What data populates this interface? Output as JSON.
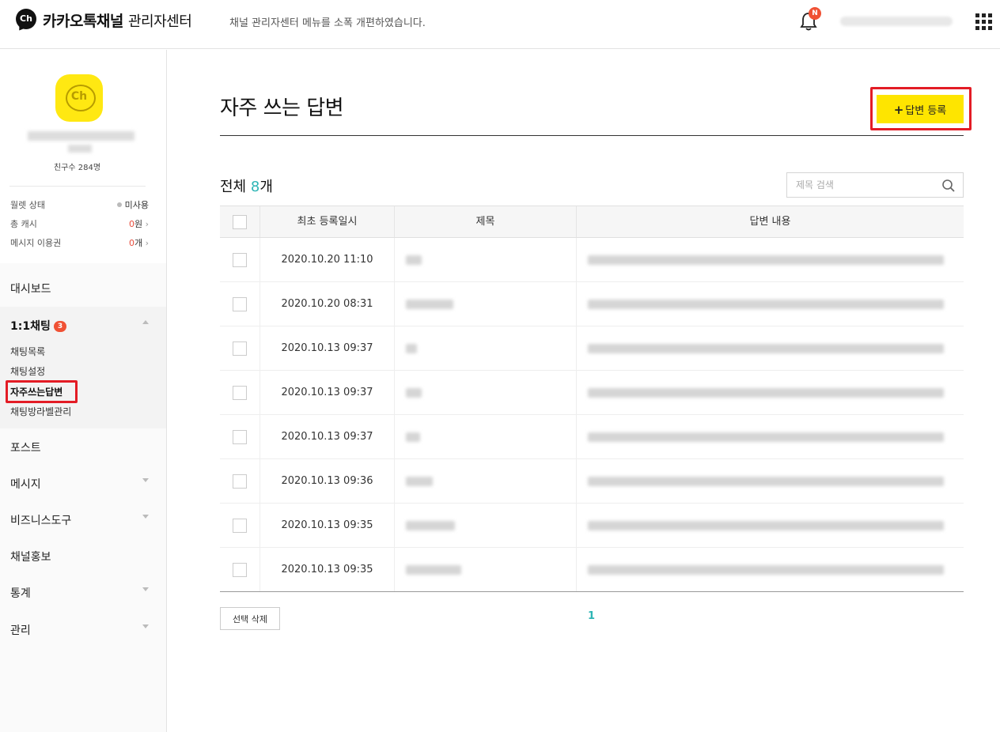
{
  "header": {
    "logo_text": "카카오톡채널",
    "logo_sub": "관리자센터",
    "notice": "채널 관리자센터 메뉴를 소폭 개편하였습니다.",
    "bell_badge": "N",
    "icons": [
      "bell-icon",
      "apps-grid-icon"
    ]
  },
  "sidebar": {
    "logo": "Ch",
    "friends": "친구수 284명",
    "stats": [
      {
        "label": "월렛 상태",
        "value": "미사용"
      },
      {
        "label": "총 캐시",
        "value_num": "0",
        "value_unit": "원"
      },
      {
        "label": "메시지 이용권",
        "value_num": "0",
        "value_unit": "개"
      }
    ],
    "menu": {
      "dashboard": "대시보드",
      "chat": "1:1채팅",
      "chat_badge": "3",
      "chat_sub": [
        "채팅목록",
        "채팅설정",
        "자주쓰는답변",
        "채팅방라벨관리"
      ],
      "post": "포스트",
      "message": "메시지",
      "biz": "비즈니스도구",
      "promo": "채널홍보",
      "stats": "통계",
      "manage": "관리"
    }
  },
  "main": {
    "title": "자주 쓰는 답변",
    "add_button": "답변 등록",
    "total_label": "전체",
    "total_count": "8",
    "total_unit": "개",
    "search_placeholder": "제목 검색",
    "columns": [
      "최초 등록일시",
      "제목",
      "답변 내용"
    ],
    "rows": [
      {
        "date": "2020.10.20 11:10"
      },
      {
        "date": "2020.10.20 08:31"
      },
      {
        "date": "2020.10.13 09:37"
      },
      {
        "date": "2020.10.13 09:37"
      },
      {
        "date": "2020.10.13 09:37"
      },
      {
        "date": "2020.10.13 09:36"
      },
      {
        "date": "2020.10.13 09:35"
      },
      {
        "date": "2020.10.13 09:35"
      }
    ],
    "delete_button": "선택 삭제",
    "page": "1"
  },
  "colors": {
    "accent": "#fee500",
    "teal": "#2eb5b5",
    "badge": "#f05134",
    "highlight": "#e31c25"
  }
}
